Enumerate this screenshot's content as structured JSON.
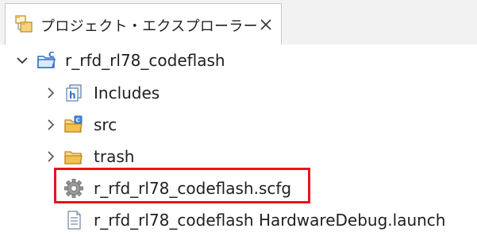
{
  "tab": {
    "title": "プロジェクト・エクスプローラー",
    "icon": "project-explorer-icon",
    "close_icon": "close-icon"
  },
  "tree": {
    "project": {
      "label": "r_rfd_rl78_codeflash",
      "expanded": true,
      "icon": "c-project-folder-icon"
    },
    "children": [
      {
        "label": "Includes",
        "icon": "includes-icon",
        "expandable": true
      },
      {
        "label": "src",
        "icon": "source-folder-icon",
        "expandable": true
      },
      {
        "label": "trash",
        "icon": "folder-icon",
        "expandable": true
      },
      {
        "label": "r_rfd_rl78_codeflash.scfg",
        "icon": "gear-icon",
        "expandable": false,
        "highlighted": true
      },
      {
        "label": "r_rfd_rl78_codeflash HardwareDebug.launch",
        "icon": "document-icon",
        "expandable": false
      }
    ]
  },
  "colors": {
    "highlight": "#e8141c",
    "folder": "#e8b34a",
    "accent_blue": "#2f6fc2"
  }
}
